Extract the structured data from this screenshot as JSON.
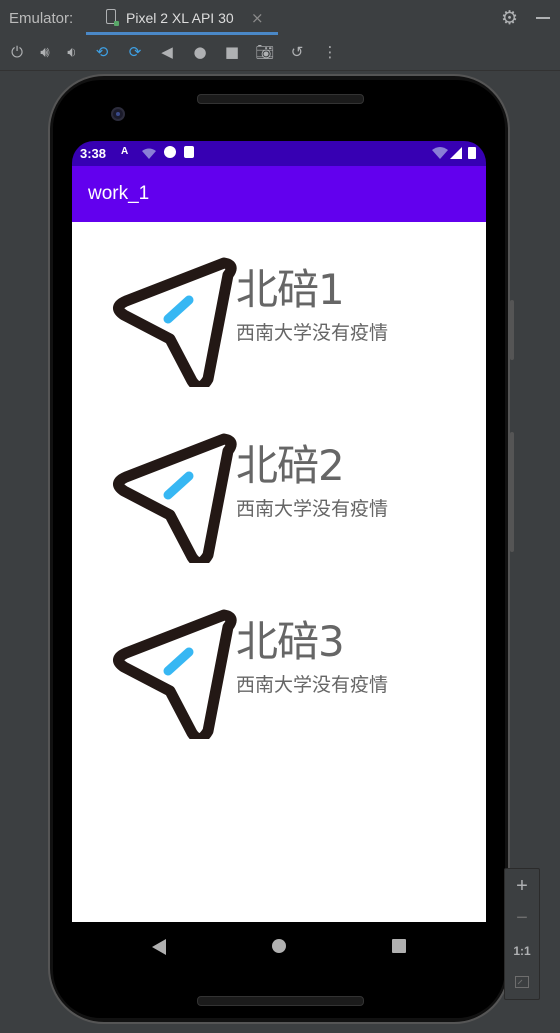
{
  "ide": {
    "emulator_label": "Emulator:",
    "tab_title": "Pixel 2 XL API 30",
    "tab_close": "×",
    "toolbar_icons": [
      "power-icon",
      "volume-up-icon",
      "volume-down-icon",
      "rotate-left-icon",
      "rotate-right-icon",
      "back-icon",
      "home-icon",
      "overview-icon",
      "screenshot-icon",
      "snapshot-icon",
      "more-icon"
    ]
  },
  "status": {
    "time": "3:38"
  },
  "app": {
    "title": "work_1"
  },
  "items": [
    {
      "title": "北碚1",
      "subtitle": "西南大学没有疫情"
    },
    {
      "title": "北碚2",
      "subtitle": "西南大学没有疫情"
    },
    {
      "title": "北碚3",
      "subtitle": "西南大学没有疫情"
    }
  ],
  "zoom": {
    "plus": "+",
    "minus": "−",
    "one_to_one": "1:1"
  },
  "colors": {
    "status_bar": "#3700b3",
    "app_bar": "#6200ee",
    "icon_outline": "#231815",
    "icon_accent": "#37b7f3"
  }
}
